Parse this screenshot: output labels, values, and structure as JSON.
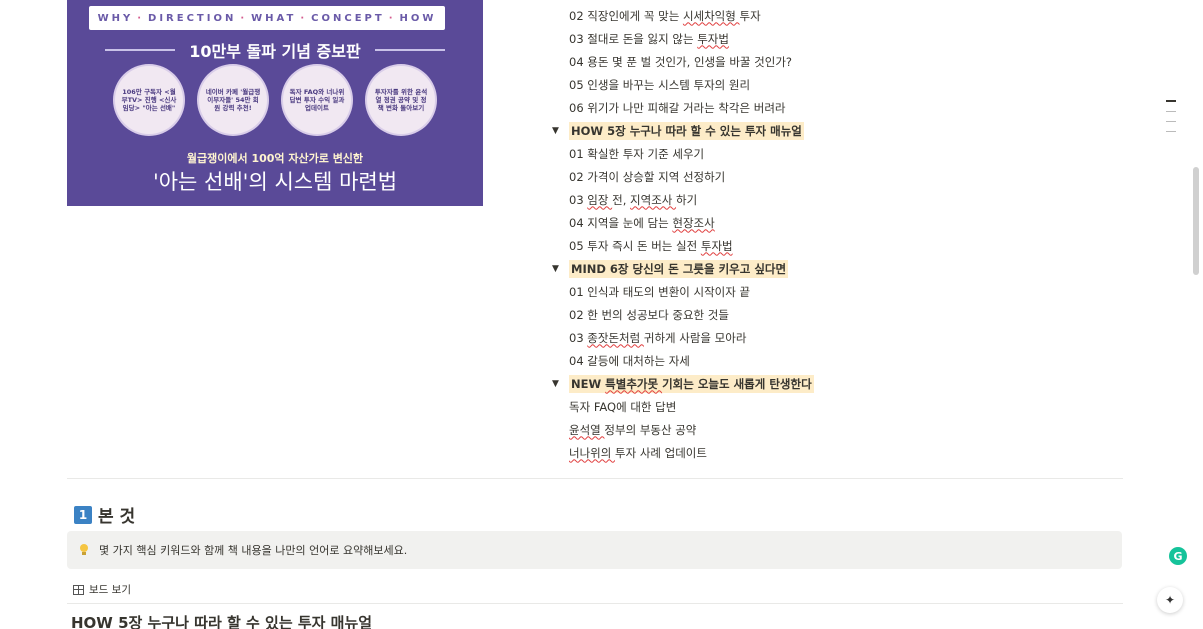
{
  "cover": {
    "top_strip": [
      "WHY",
      "DIRECTION",
      "WHAT",
      "CONCEPT",
      "HOW"
    ],
    "banner": "10만부 돌파 기념 증보판",
    "circles": [
      "106만 구독자 <월부TV> 진행 <신사임당> \"아는 선배\"",
      "네이버 카페 '월급쟁이부자들' 54만 회원 강력 추천!",
      "독자 FAQ와 너나위 답변 투자 수익 일과 업데이트",
      "투자자를 위한 윤석열 정권 공약 및 정책 변화 돌아보기"
    ],
    "subtitle": "월급쟁이에서 100억 자산가로 변신한",
    "main_title": "'아는 선배'의 시스템 마련법"
  },
  "toc": [
    {
      "type": "child",
      "text": "02 직장인에게 꼭 맞는 시세차익형 투자"
    },
    {
      "type": "child",
      "text": "03 절대로 돈을 잃지 않는 투자법"
    },
    {
      "type": "child",
      "text": "04 용돈 몇 푼 벌 것인가, 인생을 바꿀 것인가?"
    },
    {
      "type": "child",
      "text": "05 인생을 바꾸는 시스템 투자의 원리"
    },
    {
      "type": "child",
      "text": "06 위기가 나만 피해갈 거라는 착각은 버려라"
    },
    {
      "type": "parent",
      "text": "HOW 5장 누구나 따라 할 수 있는 투자 매뉴얼"
    },
    {
      "type": "child",
      "text": "01 확실한 투자 기준 세우기"
    },
    {
      "type": "child",
      "text": "02 가격이 상승할 지역 선정하기"
    },
    {
      "type": "child",
      "text": "03 임장 전, 지역조사 하기"
    },
    {
      "type": "child",
      "text": "04 지역을 눈에 담는 현장조사"
    },
    {
      "type": "child",
      "text": "05 투자 즉시 돈 버는 실전 투자법"
    },
    {
      "type": "parent",
      "text": "MIND 6장 당신의 돈 그릇을 키우고 싶다면"
    },
    {
      "type": "child",
      "text": "01 인식과 태도의 변환이 시작이자 끝"
    },
    {
      "type": "child",
      "text": "02 한 번의 성공보다 중요한 것들"
    },
    {
      "type": "child",
      "text": "03 종잣돈처럼 귀하게 사람을 모아라"
    },
    {
      "type": "child",
      "text": "04 갈등에 대처하는 자세"
    },
    {
      "type": "parent",
      "text": "NEW 특별추가못 기회는 오늘도 새롭게 탄생한다"
    },
    {
      "type": "child",
      "text": "독자 FAQ에 대한 답변"
    },
    {
      "type": "child",
      "text": "윤석열 정부의 부동산 공약"
    },
    {
      "type": "child",
      "text": "너나위의 투자 사례 업데이트"
    }
  ],
  "section": {
    "number": "1",
    "title": "본 것"
  },
  "callout": {
    "icon": "lightbulb-icon",
    "text": "몇 가지 핵심 키워드와 함께 책 내용을 나만의 언어로 요약해보세요."
  },
  "board_view": {
    "label": "보드 보기"
  },
  "board_title": "HOW 5장 누구나 따라 할 수 있는 투자 매뉴얼",
  "grammarly_label": "G",
  "ai_label": "✦",
  "colors": {
    "cover_bg": "#5a4a98",
    "toggle_highlight": "#fdecc8",
    "callout_bg": "#f1f1ef",
    "number_badge": "#3b82c4"
  }
}
